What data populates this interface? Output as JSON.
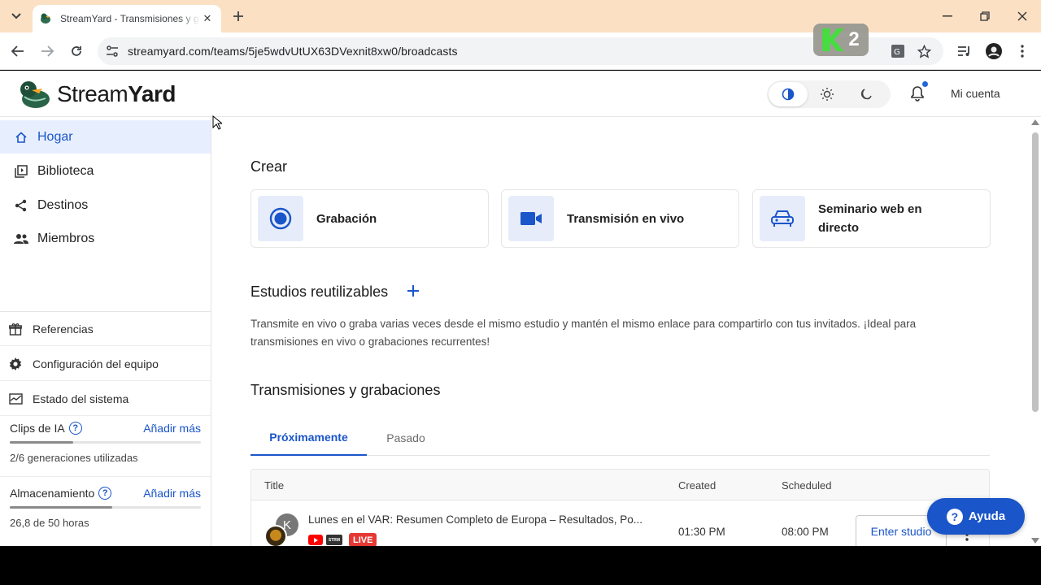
{
  "browser": {
    "tab_title": "StreamYard - Transmisiones y grabaciones",
    "url": "streamyard.com/teams/5je5wdvUtUX63DVexnit8xw0/broadcasts",
    "extension_badge": "2"
  },
  "header": {
    "logo_bold": "Stream",
    "logo_rest": "Yard",
    "account_label": "Mi cuenta"
  },
  "sidebar": {
    "nav": [
      {
        "label": "Hogar",
        "icon": "home-icon",
        "active": true
      },
      {
        "label": "Biblioteca",
        "icon": "library-icon"
      },
      {
        "label": "Destinos",
        "icon": "share-icon"
      },
      {
        "label": "Miembros",
        "icon": "people-icon"
      }
    ],
    "secondary": [
      {
        "label": "Referencias",
        "icon": "gift-icon"
      },
      {
        "label": "Configuración del equipo",
        "icon": "gear-icon"
      },
      {
        "label": "Estado del sistema",
        "icon": "monitor-icon"
      }
    ],
    "ai_clips": {
      "title": "Clips de IA",
      "link": "Añadir más",
      "usage": "2/6 generaciones utilizadas",
      "fraction": 0.333
    },
    "storage": {
      "title": "Almacenamiento",
      "link": "Añadir más",
      "usage": "26,8 de 50 horas",
      "fraction": 0.536
    }
  },
  "main": {
    "create_heading": "Crear",
    "create_cards": [
      {
        "label": "Grabación",
        "icon": "record-icon"
      },
      {
        "label": "Transmisión en vivo",
        "icon": "video-camera-icon"
      },
      {
        "label": "Seminario web en directo",
        "icon": "webinar-icon"
      }
    ],
    "studios_heading": "Estudios reutilizables",
    "studios_description": "Transmite en vivo o graba varias veces desde el mismo estudio y mantén el mismo enlace para compartirlo con tus invitados. ¡Ideal para transmisiones en vivo o grabaciones recurrentes!",
    "broadcasts_heading": "Transmisiones y grabaciones",
    "tabs": [
      "Próximamente",
      "Pasado"
    ],
    "table": {
      "columns": [
        "Title",
        "Created",
        "Scheduled"
      ],
      "rows": [
        {
          "avatar_letter": "K",
          "title": "Lunes en el VAR: Resumen Completo de Europa – Resultados, Po...",
          "live_badge": "LIVE",
          "created": "01:30 PM",
          "scheduled": "08:00 PM",
          "action": "Enter studio"
        }
      ]
    }
  },
  "help_button": "Ayuda",
  "colors": {
    "accent": "#1a55c9",
    "active_bg": "#e7efff",
    "tabstrip": "#fbe0c4",
    "live": "#e53935"
  }
}
